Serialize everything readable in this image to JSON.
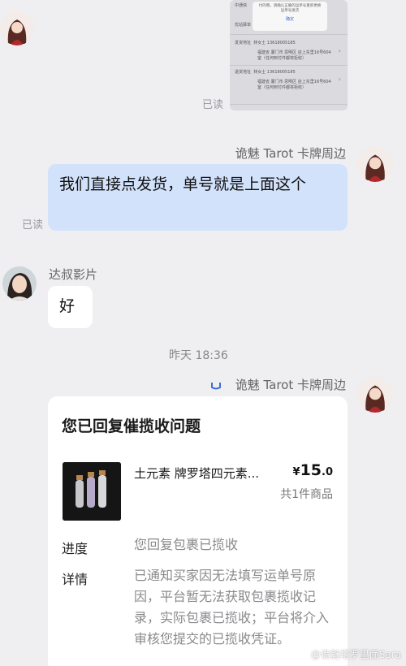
{
  "thumbnail": {
    "popup_line1": "付的哦，请确认正确的运单号重新更换",
    "popup_line2": "运单号发货",
    "popup_ok": "确定",
    "row1_label": "中通快",
    "row2_label": "优站驿单",
    "sender_label": "发货地址",
    "sender_name": "林女士 13618005185",
    "sender_addr1": "福建省 厦门市 思明区 店上东里16号604",
    "sender_addr2": "室（任何到付件都将拒收）",
    "return_label": "退货地址",
    "return_name": "林女士 13618005185",
    "return_addr1": "福建省 厦门市 思明区 店上东里16号604",
    "return_addr2": "室（任何到付件都将拒收）"
  },
  "messages": {
    "msg1_read": "已读",
    "seller_name_1": "诡魅 Tarot 卡牌周边",
    "msg2_text": "我们直接点发货，单号就是上面这个",
    "msg2_read": "已读",
    "buyer_name": "达叔影片",
    "msg3_text": "好",
    "timestamp": "昨天 18:36",
    "seller_name_2": "诡魅 Tarot 卡牌周边"
  },
  "card": {
    "title": "您已回复催揽收问题",
    "product_name": "土元素 牌罗塔四元素...",
    "price_symbol": "¥",
    "price_int": "15",
    "price_dec": ".0",
    "quantity": "共1件商品",
    "progress_label": "进度",
    "progress_value": "您回复包裹已揽收",
    "detail_label": "详情",
    "detail_value": "已通知买家因无法填写运单号原因，平台暂无法获取包裹揽收记录，实际包裹已揽收；平台将介入审核您提交的已揽收凭证。"
  },
  "watermark": "@诡魅塔罗里面Sara",
  "colors": {
    "background": "#efeff2",
    "outgoing_bubble": "#d3e2fb",
    "incoming_bubble": "#ffffff",
    "verified_badge": "#3b6fd8"
  }
}
